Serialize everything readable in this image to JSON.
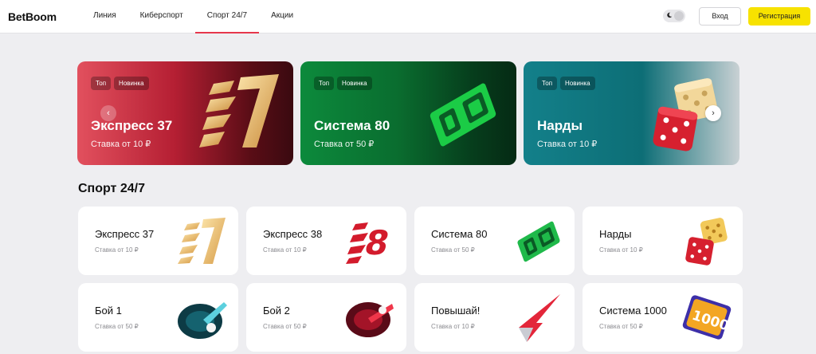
{
  "header": {
    "logo": "BetBoom",
    "nav": [
      "Линия",
      "Киберспорт",
      "Спорт 24/7",
      "Акции"
    ],
    "active_nav": "Спорт 24/7",
    "login_label": "Вход",
    "register_label": "Регистрация",
    "accent_color": "#e6374b",
    "register_color": "#f7e200"
  },
  "banners": [
    {
      "tags": [
        "Топ",
        "Новинка"
      ],
      "title": "Экспресс 37",
      "subtitle": "Ставка от 10 ₽",
      "icon": "express-37-logo"
    },
    {
      "tags": [
        "Топ",
        "Новинка"
      ],
      "title": "Система 80",
      "subtitle": "Ставка от 50 ₽",
      "icon": "sistema-80-logo"
    },
    {
      "tags": [
        "Топ",
        "Новинка"
      ],
      "title": "Нарды",
      "subtitle": "Ставка от 10 ₽",
      "icon": "dice-icon"
    }
  ],
  "section": {
    "title": "Спорт 24/7",
    "cards": [
      {
        "title": "Экспресс 37",
        "subtitle": "Ставка от 10 ₽",
        "icon": "express-37-logo"
      },
      {
        "title": "Экспресс 38",
        "subtitle": "Ставка от 10 ₽",
        "icon": "express-38-logo"
      },
      {
        "title": "Система 80",
        "subtitle": "Ставка от 50 ₽",
        "icon": "sistema-80-logo"
      },
      {
        "title": "Нарды",
        "subtitle": "Ставка от 10 ₽",
        "icon": "dice-icon"
      },
      {
        "title": "Бой 1",
        "subtitle": "Ставка от 50 ₽",
        "icon": "boi-1-arena-icon"
      },
      {
        "title": "Бой 2",
        "subtitle": "Ставка от 50 ₽",
        "icon": "boi-2-arena-icon"
      },
      {
        "title": "Повышай!",
        "subtitle": "Ставка от 10 ₽",
        "icon": "arrow-up-icon"
      },
      {
        "title": "Система 1000",
        "subtitle": "Ставка от 50 ₽",
        "icon": "sistema-1000-logo"
      }
    ]
  }
}
